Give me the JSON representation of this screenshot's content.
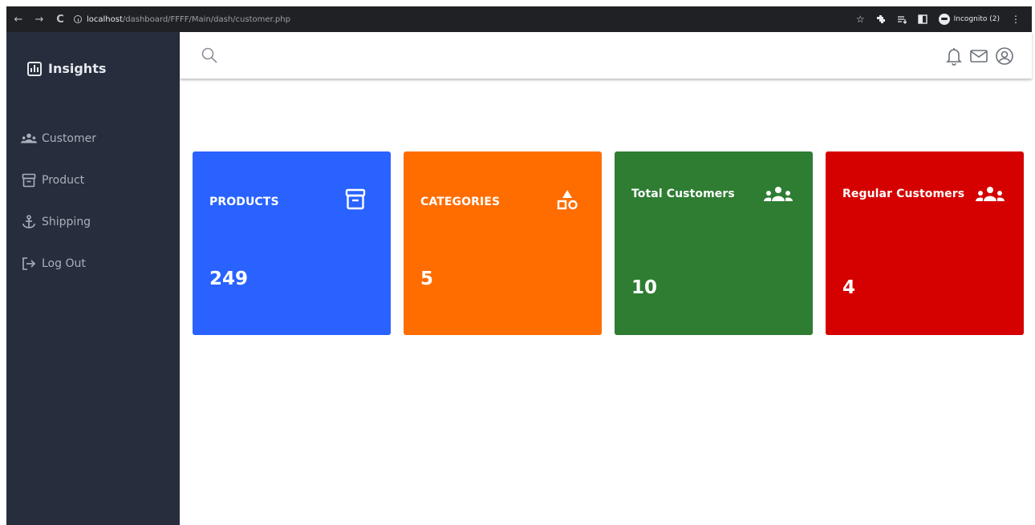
{
  "browser": {
    "back_icon": "←",
    "forward_icon": "→",
    "reload_icon": "C",
    "url_host": "localhost",
    "url_path": "/dashboard/FFFF/Main/dash/customer.php",
    "star_icon": "☆",
    "incognito_label": "Incognito (2)",
    "menu_icon": "⋮"
  },
  "sidebar": {
    "brand": "Insights",
    "items": [
      {
        "label": "Customer",
        "icon": "users-icon"
      },
      {
        "label": "Product",
        "icon": "archive-icon"
      },
      {
        "label": "Shipping",
        "icon": "anchor-icon"
      },
      {
        "label": "Log Out",
        "icon": "logout-icon"
      }
    ]
  },
  "header": {
    "icons": [
      "search-icon",
      "bell-icon",
      "mail-icon",
      "user-circle-icon"
    ]
  },
  "cards": [
    {
      "title": "PRODUCTS",
      "value": "249",
      "icon": "archive-icon",
      "color": "#2962ff"
    },
    {
      "title": "CATEGORIES",
      "value": "5",
      "icon": "shapes-icon",
      "color": "#ff6d00"
    },
    {
      "title": "Total Customers",
      "value": "10",
      "icon": "users-icon",
      "color": "#2e7d32"
    },
    {
      "title": "Regular Customers",
      "value": "4",
      "icon": "users-icon",
      "color": "#d50000"
    }
  ],
  "colors": {
    "sidebar_bg": "#262e3d",
    "sidebar_text": "#aab0bb",
    "browser_bg": "#202124"
  }
}
